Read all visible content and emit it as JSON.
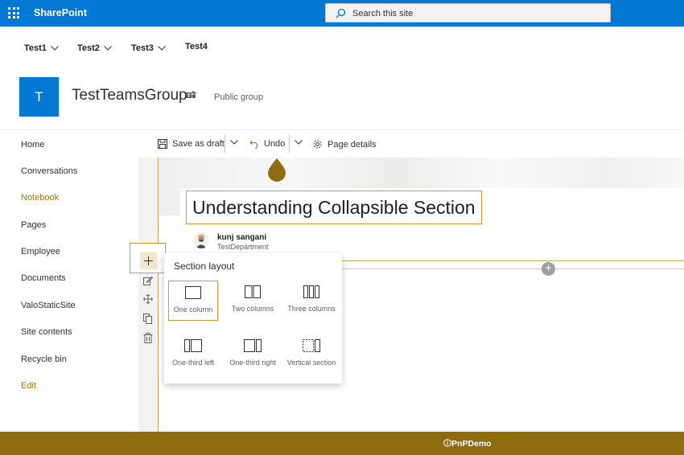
{
  "suite_bar": {
    "app_name": "SharePoint",
    "search_placeholder": "Search this site"
  },
  "hub_nav": [
    "Test1",
    "Test2",
    "Test3",
    "Test4"
  ],
  "site": {
    "icon_letter": "T",
    "title": "TestTeamsGroup",
    "type": "Public group"
  },
  "left_nav": {
    "items": [
      "Home",
      "Conversations",
      "Notebook",
      "Pages",
      "Employee",
      "Documents",
      "ValoStaticSite",
      "Site contents",
      "Recycle bin"
    ],
    "active": "Notebook",
    "edit_label": "Edit"
  },
  "command_bar": {
    "save_label": "Save as draft",
    "undo_label": "Undo",
    "details_label": "Page details"
  },
  "page": {
    "title": "Understanding Collapsible Section",
    "author_name": "kunj sangani",
    "author_department": "TestDepartment"
  },
  "section_layout": {
    "heading": "Section layout",
    "options": [
      "One column",
      "Two columns",
      "Three columns",
      "One-third left",
      "One-third right",
      "Vertical section"
    ],
    "selected": "One column"
  },
  "footer": {
    "label": "PnPDemo"
  },
  "colors": {
    "suite_bar": "#0078d4",
    "accent": "#a5740c",
    "footer": "#8f6c10",
    "highlight_border": "#e0953a"
  }
}
